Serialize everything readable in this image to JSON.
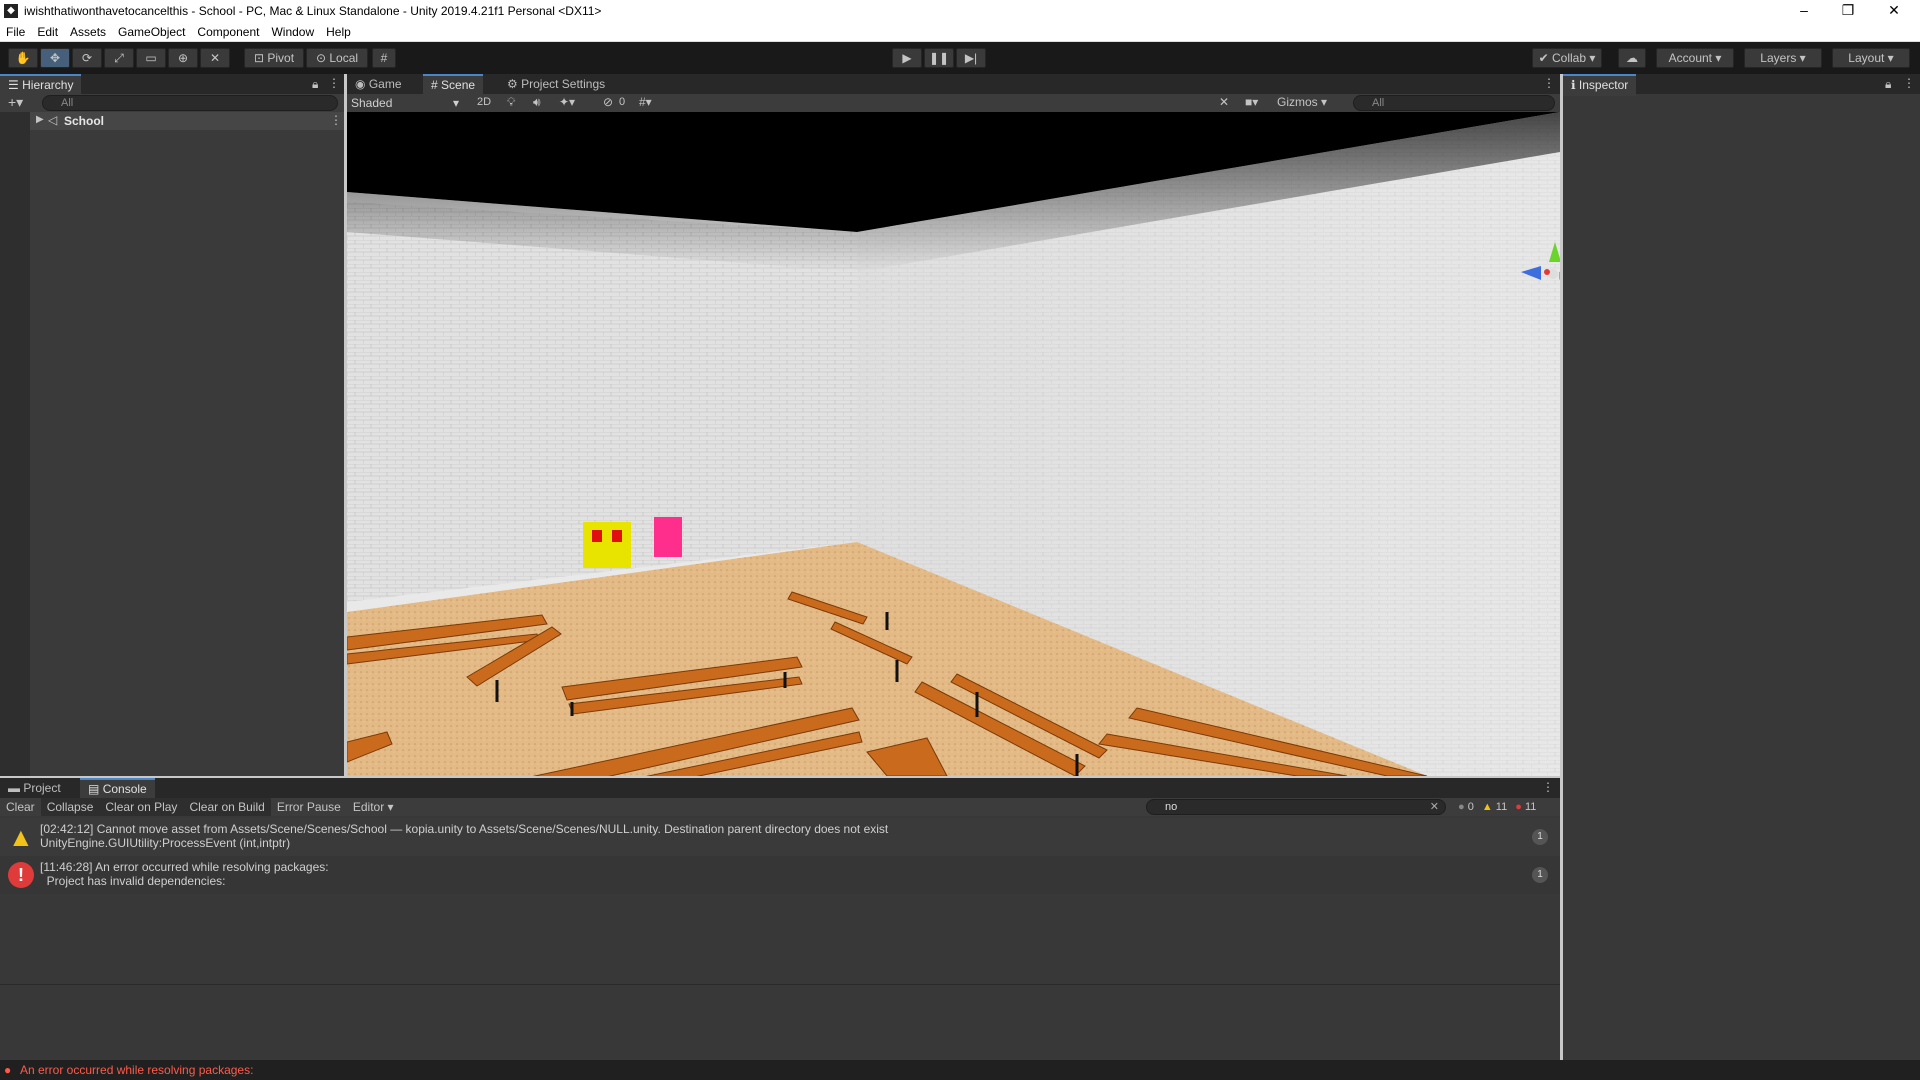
{
  "window": {
    "title": "iwishthatiwonthavetocancelthis - School - PC, Mac & Linux Standalone - Unity 2019.4.21f1 Personal <DX11>",
    "minimize": "–",
    "maximize": "❐",
    "close": "✕"
  },
  "menu": [
    "File",
    "Edit",
    "Assets",
    "GameObject",
    "Component",
    "Window",
    "Help"
  ],
  "toolbar": {
    "pivot": "Pivot",
    "local": "Local",
    "collab": "Collab",
    "account": "Account",
    "layers": "Layers",
    "layout": "Layout"
  },
  "hierarchy": {
    "tab": "Hierarchy",
    "search_placeholder": "All",
    "root_item": "School"
  },
  "scene": {
    "tabs": [
      "Game",
      "Scene",
      "Project Settings"
    ],
    "active_tab": "Scene",
    "shading": "Shaded",
    "mode_2d": "2D",
    "hidden_count": "0",
    "gizmos": "Gizmos",
    "search_placeholder": "All"
  },
  "inspector": {
    "tab": "Inspector"
  },
  "console": {
    "tabs": [
      "Project",
      "Console"
    ],
    "active_tab": "Console",
    "buttons": [
      "Clear",
      "Collapse",
      "Clear on Play",
      "Clear on Build",
      "Error Pause",
      "Editor"
    ],
    "search_value": "no",
    "counts": {
      "info": "0",
      "warnings": "11",
      "errors": "11"
    },
    "logs": [
      {
        "type": "warning",
        "line1": "[02:42:12] Cannot move asset from Assets/Scene/Scenes/School — kopia.unity to Assets/Scene/Scenes/NULL.unity. Destination parent directory does not exist",
        "line2": "UnityEngine.GUIUtility:ProcessEvent (int,intptr)",
        "count": "1"
      },
      {
        "type": "error",
        "line1": "[11:46:28] An error occurred while resolving packages:",
        "line2": "  Project has invalid dependencies:",
        "count": "1"
      }
    ]
  },
  "status": {
    "message": "An error occurred while resolving packages:"
  },
  "colors": {
    "accent": "#4a86c8",
    "warning": "#f2c21b",
    "error": "#e03b3b",
    "wood": "#c96a1c",
    "floor": "#e0b882"
  }
}
